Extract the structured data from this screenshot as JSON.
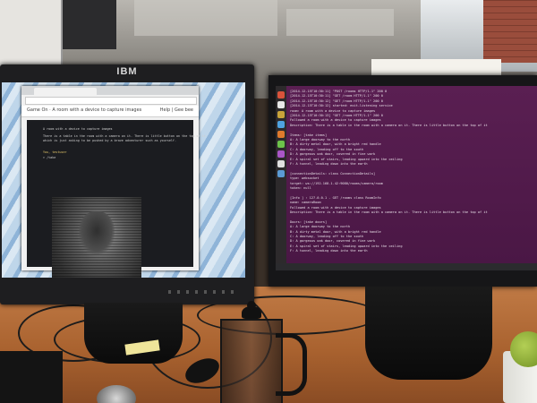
{
  "scene": {
    "left_monitor": {
      "brand": "IBM",
      "browser": {
        "app_title": "Game On · A room with a device to capture images",
        "help_text": "Help | Gee bee",
        "room_heading": "A room with a device to capture images",
        "room_description_1": "There is a table in the room with a camera on it. There is little button on the top of it",
        "room_description_2": "which is just asking to be pushed by a brave adventurer such as yourself.",
        "user_line": "You, testuser",
        "prompt_line": "> /take"
      }
    },
    "right_monitor": {
      "terminal_lines": [
        "[2014-12-15T10:30:11] \"POST /rooms HTTP/1.1\" 200 0",
        "[2014-12-15T10:30:11] \"GET /room HTTP/1.1\" 200 0",
        "[2014-12-15T10:30:12] \"GET /room HTTP/1.1\" 200 0",
        "[2014-12-15T10:30:12] started: exit-listening service",
        "room: A room with a device to capture images",
        "[2014-12-15T10:30:13] \"GET /room HTTP/1.1\" 200 0",
        "Followed a room with a device to capture images",
        "Description: There is a table in the room with a camera on it. There is little button on the top of it",
        "",
        "Items: [take items]",
        "  A: A large doorway to the north",
        "  B: A dirty metal door, with a bright red handle",
        "  C: A doorway, leading off to the south",
        "  D: A gorgeous oak door, covered in fine work",
        "  E: A spiral set of stairs, leading upward into the ceiling",
        "  F: A tunnel, leading down into the earth",
        "",
        "[connectionDetails: class ConnectionDetails]",
        "  type: websocket",
        "  target: ws://192.168.1.42:9080/rooms/camera/room",
        "  token: null",
        "",
        "[Info   ] : 127.0.0.1 - GET /rooms class RoomInfo",
        "  name: cameraRoom",
        "Followed a room with a device to capture images",
        "Description: There is a table in the room with a camera on it. There is little button on the top of it",
        "",
        "Doors: [take doors]",
        "  A: A large doorway to the north",
        "  B: A dirty metal door, with a bright red handle",
        "  C: A doorway, leading off to the south",
        "  D: A gorgeous oak door, covered in fine work",
        "  E: A spiral set of stairs, leading upward into the ceiling",
        "  F: A tunnel, leading down into the earth"
      ],
      "launcher_colors": [
        "#d9533b",
        "#e8e8e8",
        "#c9a43a",
        "#4fa3e0",
        "#e07a2c",
        "#6cc24a",
        "#aa56c8",
        "#e0e0e0",
        "#5b9bd5"
      ]
    }
  }
}
